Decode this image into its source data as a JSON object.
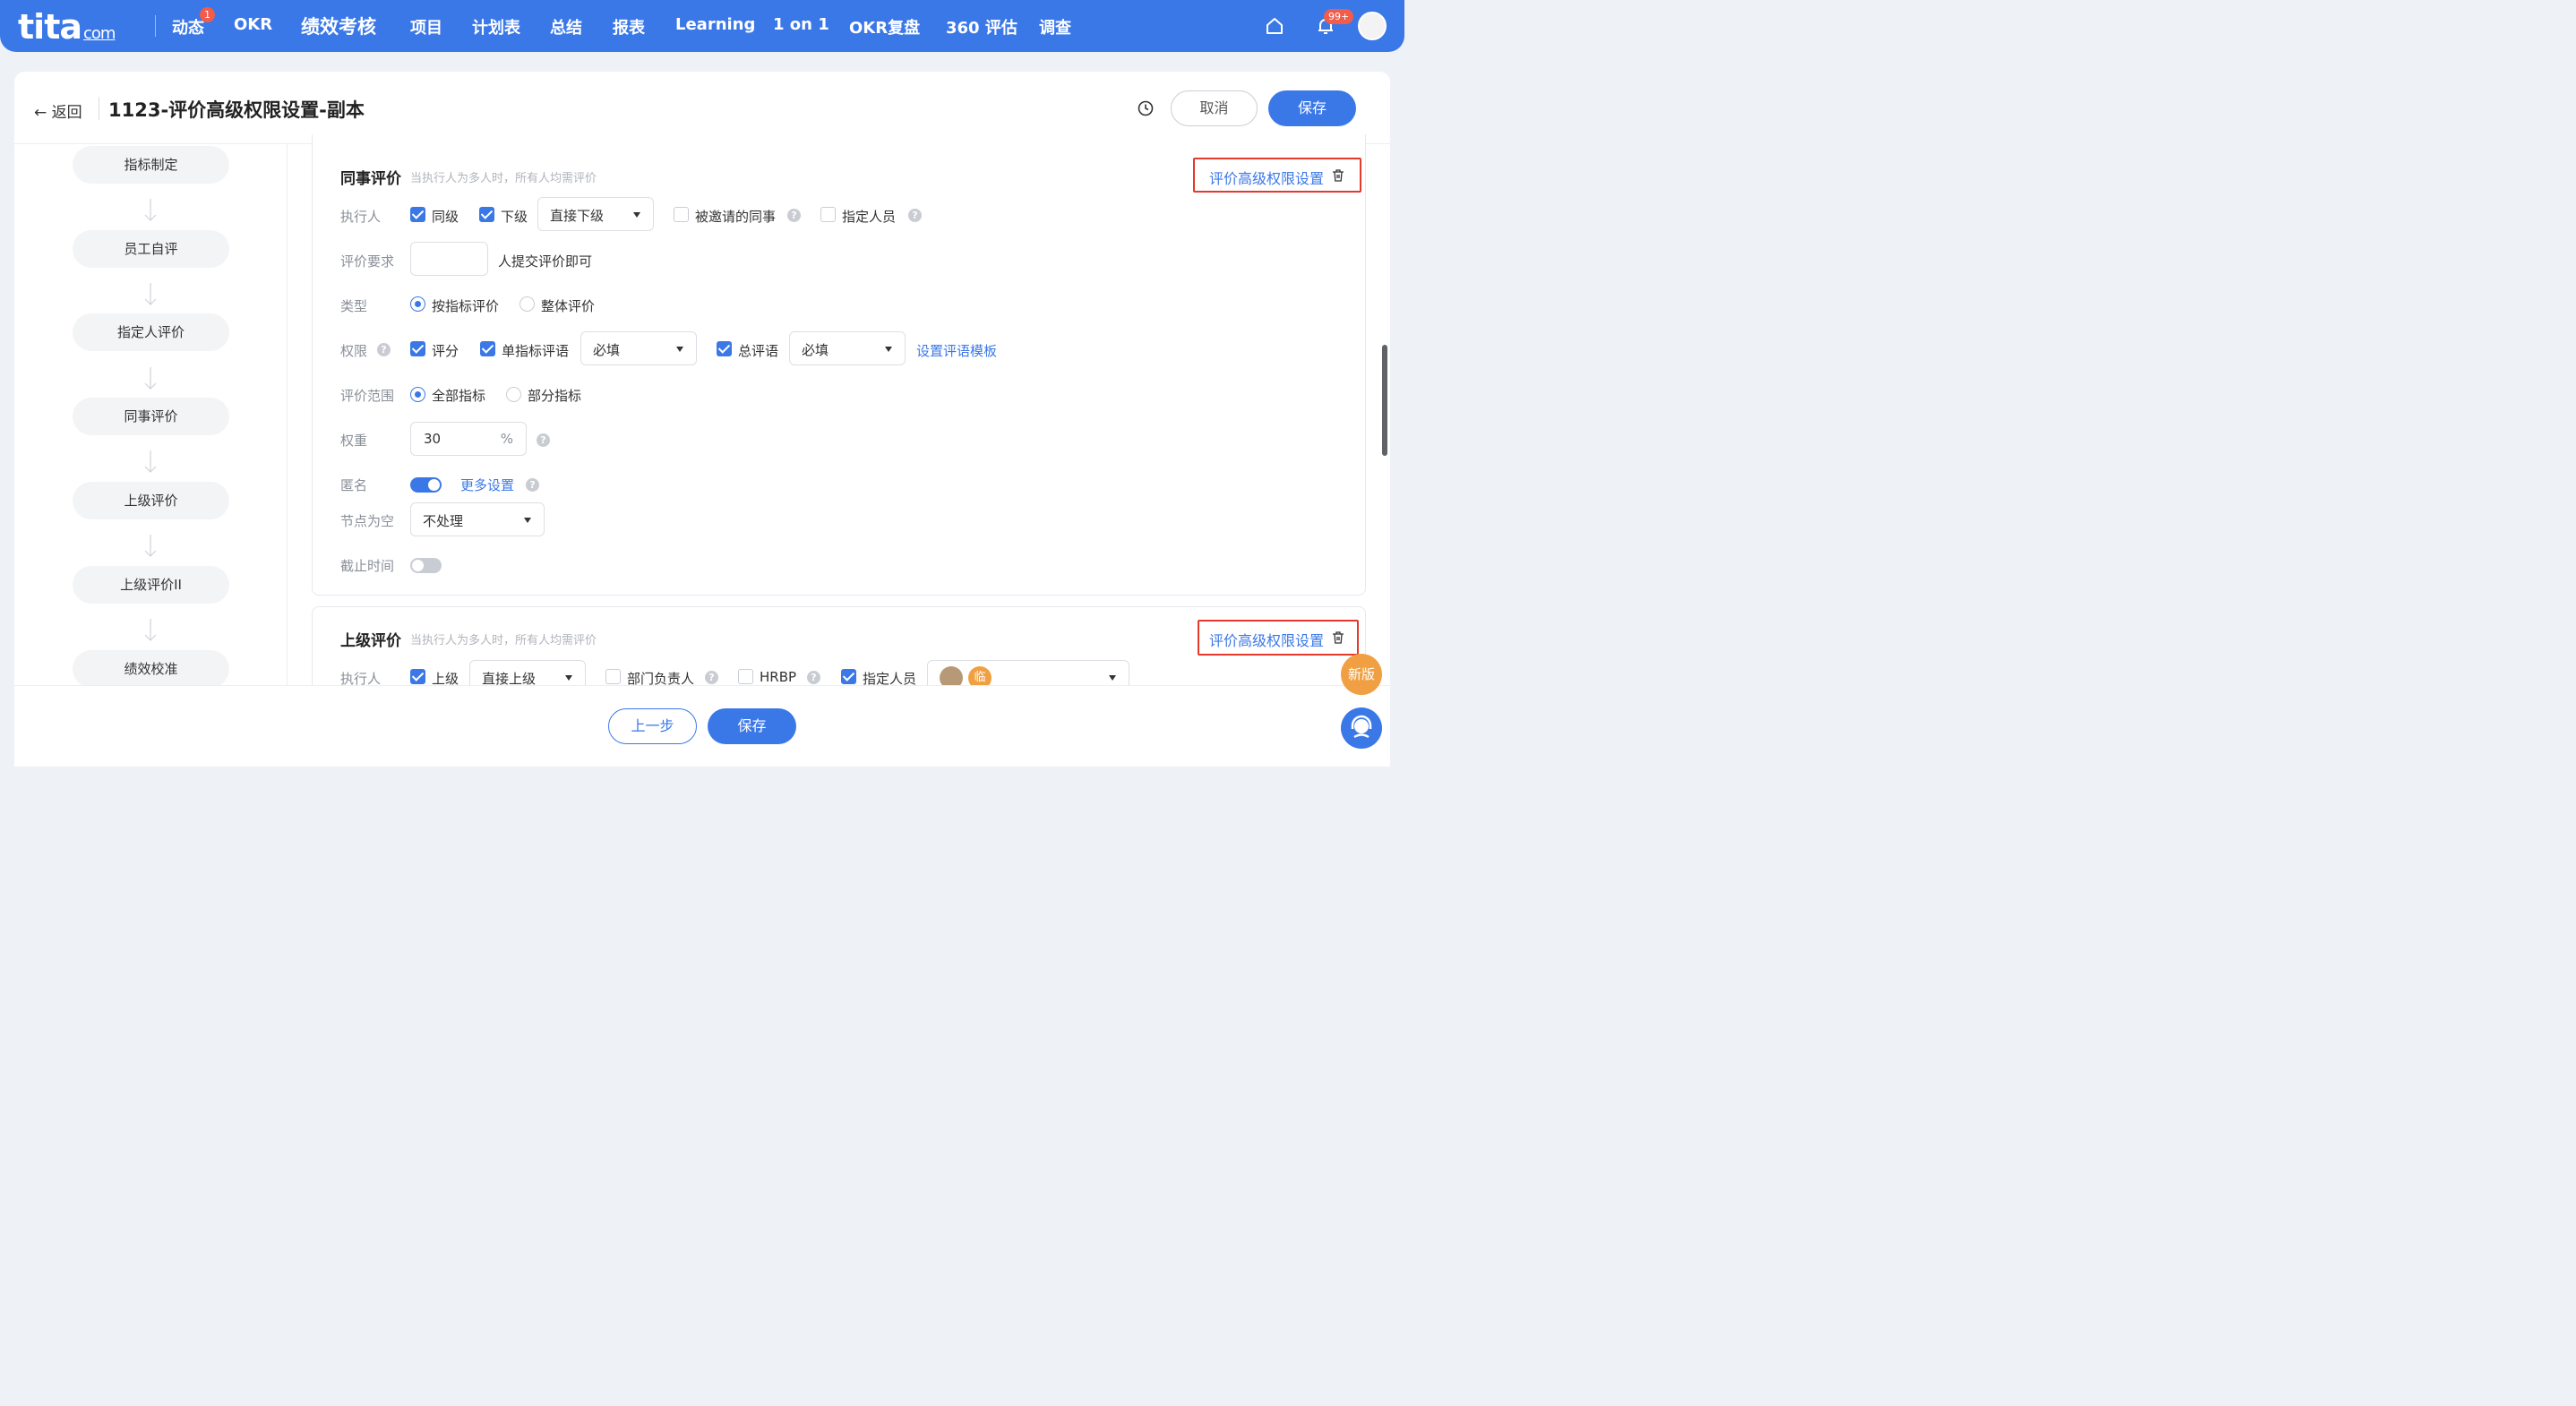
{
  "nav": {
    "logo": "tita",
    "logo_suffix": "com",
    "items": [
      "动态",
      "OKR",
      "绩效考核",
      "项目",
      "计划表",
      "总结",
      "报表",
      "Learning",
      "1 on 1",
      "OKR复盘",
      "360 评估",
      "调查"
    ],
    "dynamic_badge": "1",
    "bell_badge": "99+"
  },
  "header": {
    "back_label": "返回",
    "title": "1123-评价高级权限设置-副本",
    "cancel_label": "取消",
    "save_label": "保存"
  },
  "steps": [
    "指标制定",
    "员工自评",
    "指定人评价",
    "同事评价",
    "上级评价",
    "上级评价II",
    "绩效校准"
  ],
  "peer": {
    "title": "同事评价",
    "hint": "当执行人为多人时，所有人均需评价",
    "adv_link": "评价高级权限设置",
    "executor_label": "执行人",
    "exec_same_level": "同级",
    "exec_subordinate": "下级",
    "subordinate_select": "直接下级",
    "exec_invited": "被邀请的同事",
    "exec_designated": "指定人员",
    "requirement_label": "评价要求",
    "requirement_input": "",
    "requirement_suffix": "人提交评价即可",
    "type_label": "类型",
    "type_by_indicator": "按指标评价",
    "type_overall": "整体评价",
    "permission_label": "权限",
    "perm_score": "评分",
    "perm_single_comment": "单指标评语",
    "single_comment_select": "必填",
    "perm_total_comment": "总评语",
    "total_comment_select": "必填",
    "comment_template_link": "设置评语模板",
    "scope_label": "评价范围",
    "scope_all": "全部指标",
    "scope_part": "部分指标",
    "weight_label": "权重",
    "weight_value": "30",
    "weight_unit": "%",
    "anonymous_label": "匿名",
    "anonymous_on": true,
    "more_settings_link": "更多设置",
    "empty_node_label": "节点为空",
    "empty_node_select": "不处理",
    "deadline_label": "截止时间",
    "deadline_on": false
  },
  "superior": {
    "title": "上级评价",
    "hint": "当执行人为多人时，所有人均需评价",
    "adv_link": "评价高级权限设置",
    "executor_label": "执行人",
    "exec_superior": "上级",
    "superior_select": "直接上级",
    "exec_dept_head": "部门负责人",
    "exec_hrbp": "HRBP",
    "exec_designated": "指定人员",
    "designated_avatar_text": "临"
  },
  "bottom": {
    "prev_label": "上一步",
    "save_label": "保存"
  },
  "float": {
    "new_version": "新版"
  },
  "colors": {
    "primary": "#3b78e7",
    "highlight_border": "#e5392c",
    "badge": "#f25c4a"
  }
}
